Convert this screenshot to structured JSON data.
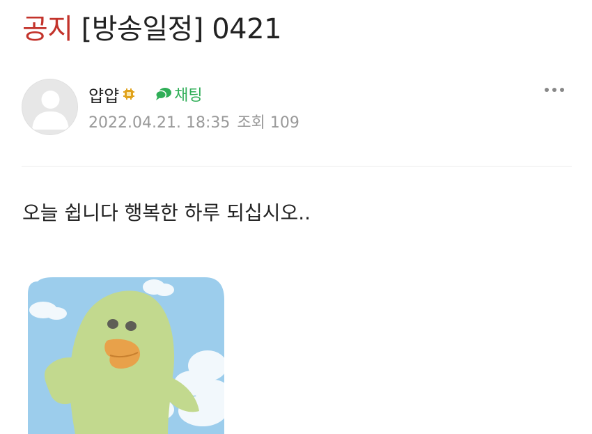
{
  "post": {
    "category_tag": "공지",
    "title": "[방송일정] 0421",
    "author": "얍얍",
    "chat_label": "채팅",
    "date": "2022.04.21. 18:35",
    "views": "조회 109",
    "body": "오늘 쉽니다 행복한 하루 되십시오.."
  },
  "icons": {
    "avatar": "default-profile-icon",
    "grade": "member-grade-icon",
    "chat": "speech-bubble-icon",
    "more": "more-dots-icon",
    "sticker": "duck-sticker-image"
  },
  "colors": {
    "notice": "#c3332b",
    "chat": "#2fae57",
    "meta": "#999999",
    "sticker_sky": "#9ccdec",
    "sticker_duck": "#c2d98e"
  }
}
